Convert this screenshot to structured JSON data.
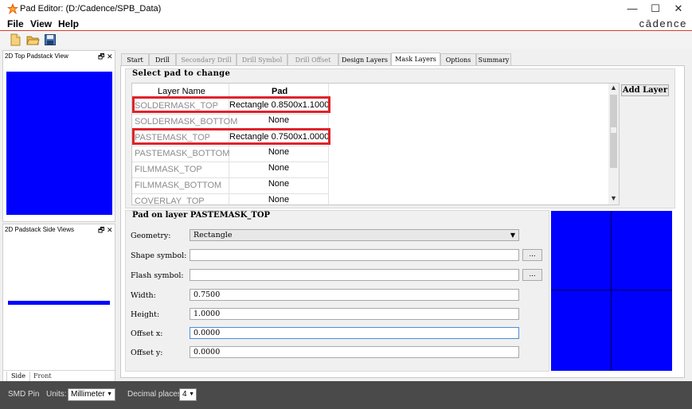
{
  "window": {
    "title": "Pad Editor:  (D:/Cadence/SPB_Data)",
    "controls": [
      "—",
      "☐",
      "✕"
    ]
  },
  "menu": {
    "file": "File",
    "view": "View",
    "help": "Help"
  },
  "brand": "cādence",
  "dock": {
    "top_view_title": "2D Top Padstack View",
    "side_view_title": "2D Padstack Side Views",
    "float_close": "🗗 ✕",
    "tabs": [
      "Side",
      "Front"
    ]
  },
  "tabs": [
    "Start",
    "Drill",
    "Secondary Drill",
    "Drill Symbol",
    "Drill Offset",
    "Design Layers",
    "Mask Layers",
    "Options",
    "Summary"
  ],
  "active_tab": "Mask Layers",
  "select_pad": {
    "heading": "Select pad to change",
    "col_layer": "Layer Name",
    "col_pad": "Pad",
    "rows": [
      {
        "layer": "SOLDERMASK_TOP",
        "pad": "Rectangle 0.8500x1.1000"
      },
      {
        "layer": "SOLDERMASK_BOTTOM",
        "pad": "None"
      },
      {
        "layer": "PASTEMASK_TOP",
        "pad": "Rectangle 0.7500x1.0000"
      },
      {
        "layer": "PASTEMASK_BOTTOM",
        "pad": "None"
      },
      {
        "layer": "FILMMASK_TOP",
        "pad": "None"
      },
      {
        "layer": "FILMMASK_BOTTOM",
        "pad": "None"
      },
      {
        "layer": "COVERLAY_TOP",
        "pad": "None"
      }
    ],
    "add_layer": "Add Layer"
  },
  "pad_on_layer": {
    "heading": "Pad on layer PASTEMASK_TOP",
    "geometry_label": "Geometry:",
    "geometry_value": "Rectangle",
    "shape_symbol_label": "Shape symbol:",
    "shape_symbol_value": "",
    "flash_symbol_label": "Flash symbol:",
    "flash_symbol_value": "",
    "browse": "...",
    "width_label": "Width:",
    "width_value": "0.7500",
    "height_label": "Height:",
    "height_value": "1.0000",
    "offset_x_label": "Offset x:",
    "offset_x_value": "0.0000",
    "offset_y_label": "Offset y:",
    "offset_y_value": "0.0000"
  },
  "status": {
    "pad_type": "SMD Pin",
    "units_label": "Units:",
    "units_value": "Millimeter",
    "decimal_label": "Decimal places:",
    "decimal_value": "4"
  },
  "colors": {
    "preview_blue": "#0000ff",
    "highlight_red": "#e0222a"
  }
}
